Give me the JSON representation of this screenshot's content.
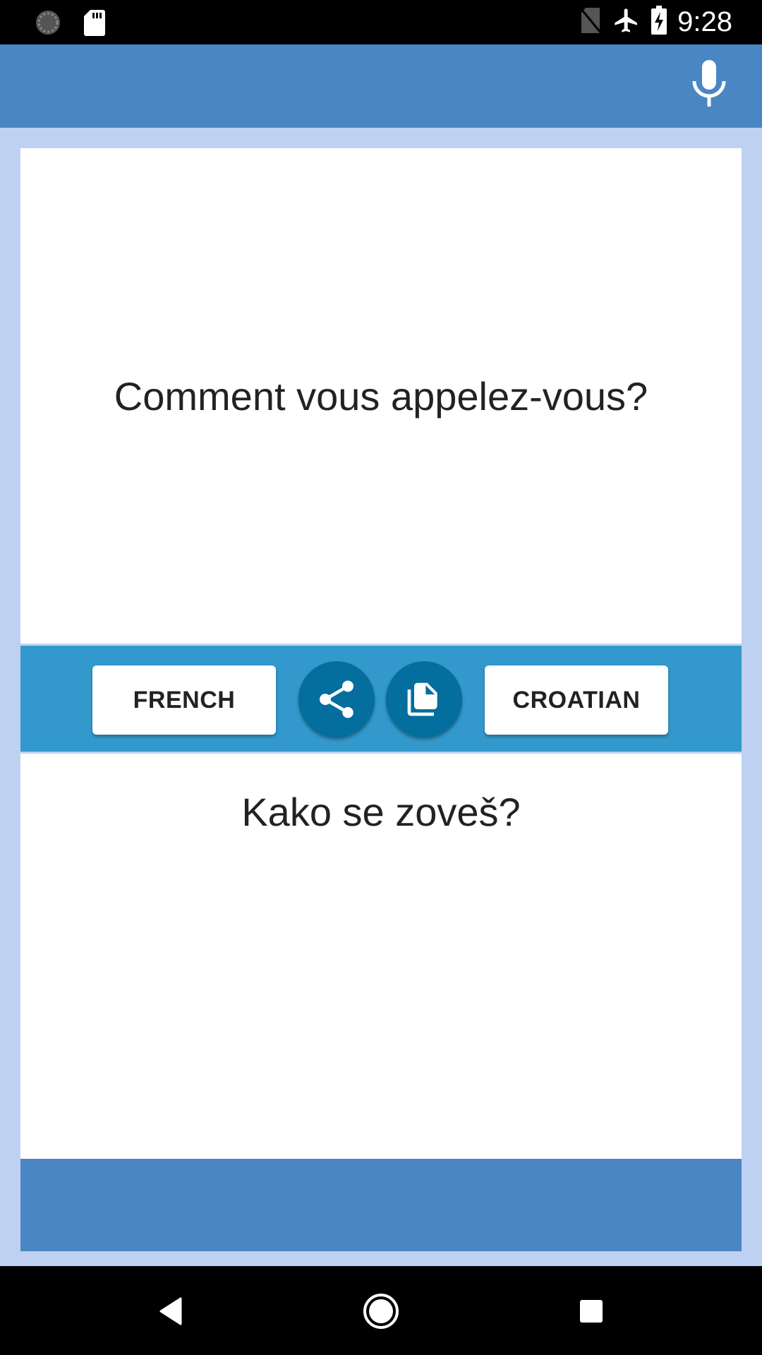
{
  "status_bar": {
    "time": "9:28",
    "left_icons": [
      "sync-icon",
      "sd-card-icon"
    ],
    "right_icons": [
      "no-sim-icon",
      "airplane-mode-icon",
      "battery-charging-icon"
    ]
  },
  "app_bar": {
    "mic_icon": "microphone-icon"
  },
  "translation": {
    "source_text": "Comment vous appelez-vous?",
    "target_text": "Kako se zoveš?"
  },
  "controls": {
    "source_language": "FRENCH",
    "target_language": "CROATIAN",
    "share_icon": "share-icon",
    "copy_icon": "copy-icon"
  },
  "navigation": {
    "back": "back-icon",
    "home": "home-icon",
    "recents": "recents-icon"
  },
  "colors": {
    "app_bar": "#4a86c3",
    "background": "#bfd1f2",
    "band": "#3399cc",
    "circle_button": "#046e9e"
  }
}
